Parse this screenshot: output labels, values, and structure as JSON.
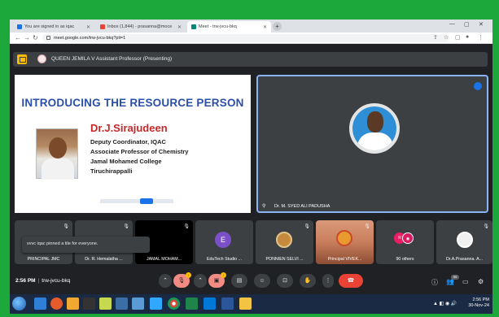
{
  "browser": {
    "tabs": [
      {
        "label": "You are signed in as iqac",
        "fav_color": "#1a73e8"
      },
      {
        "label": "Inbox (1,844) - prasanna@moce",
        "fav_color": "#ea4335"
      },
      {
        "label": "Meet - trw-jvcu-bkq",
        "fav_color": "#00897b"
      }
    ],
    "url": "meet.google.com/trw-jvcu-bkq?pli=1"
  },
  "presenting_bar": {
    "text": "QUEEN JEMILA V Assistant Professor (Presenting)"
  },
  "slide": {
    "title": "INTRODUCING THE RESOURCE PERSON",
    "speaker_name": "Dr.J.Sirajudeen",
    "lines": [
      "Deputy Coordinator, IQAC",
      "Associate Professor of Chemistry",
      "Jamal Mohamed College",
      "Tiruchirappalli"
    ]
  },
  "active_speaker": {
    "name": "Dr. M. SYED ALI PADUSHA"
  },
  "participants": [
    {
      "label": "PRINCIPAL JMC"
    },
    {
      "label": "Dr. R. Hemalatha ..."
    },
    {
      "label": "JAMAL MOHAM..."
    },
    {
      "label": "EduTech Studio ...",
      "initial": "E",
      "avatar_color": "#7b4fc7"
    },
    {
      "label": "PONNIEN SELVI ..."
    },
    {
      "label": "Principal VIVEK..."
    },
    {
      "label": "90 others"
    },
    {
      "label": "Dr.A.Prasanna. A..."
    }
  ],
  "toast": {
    "text": "vvvc iqac pinned a tile for everyone."
  },
  "meeting": {
    "time": "2:56 PM",
    "code": "trw-jvcu-bkq",
    "participant_count": "99"
  },
  "taskbar": {
    "time": "2:56 PM",
    "date": "30-Nov-24"
  }
}
